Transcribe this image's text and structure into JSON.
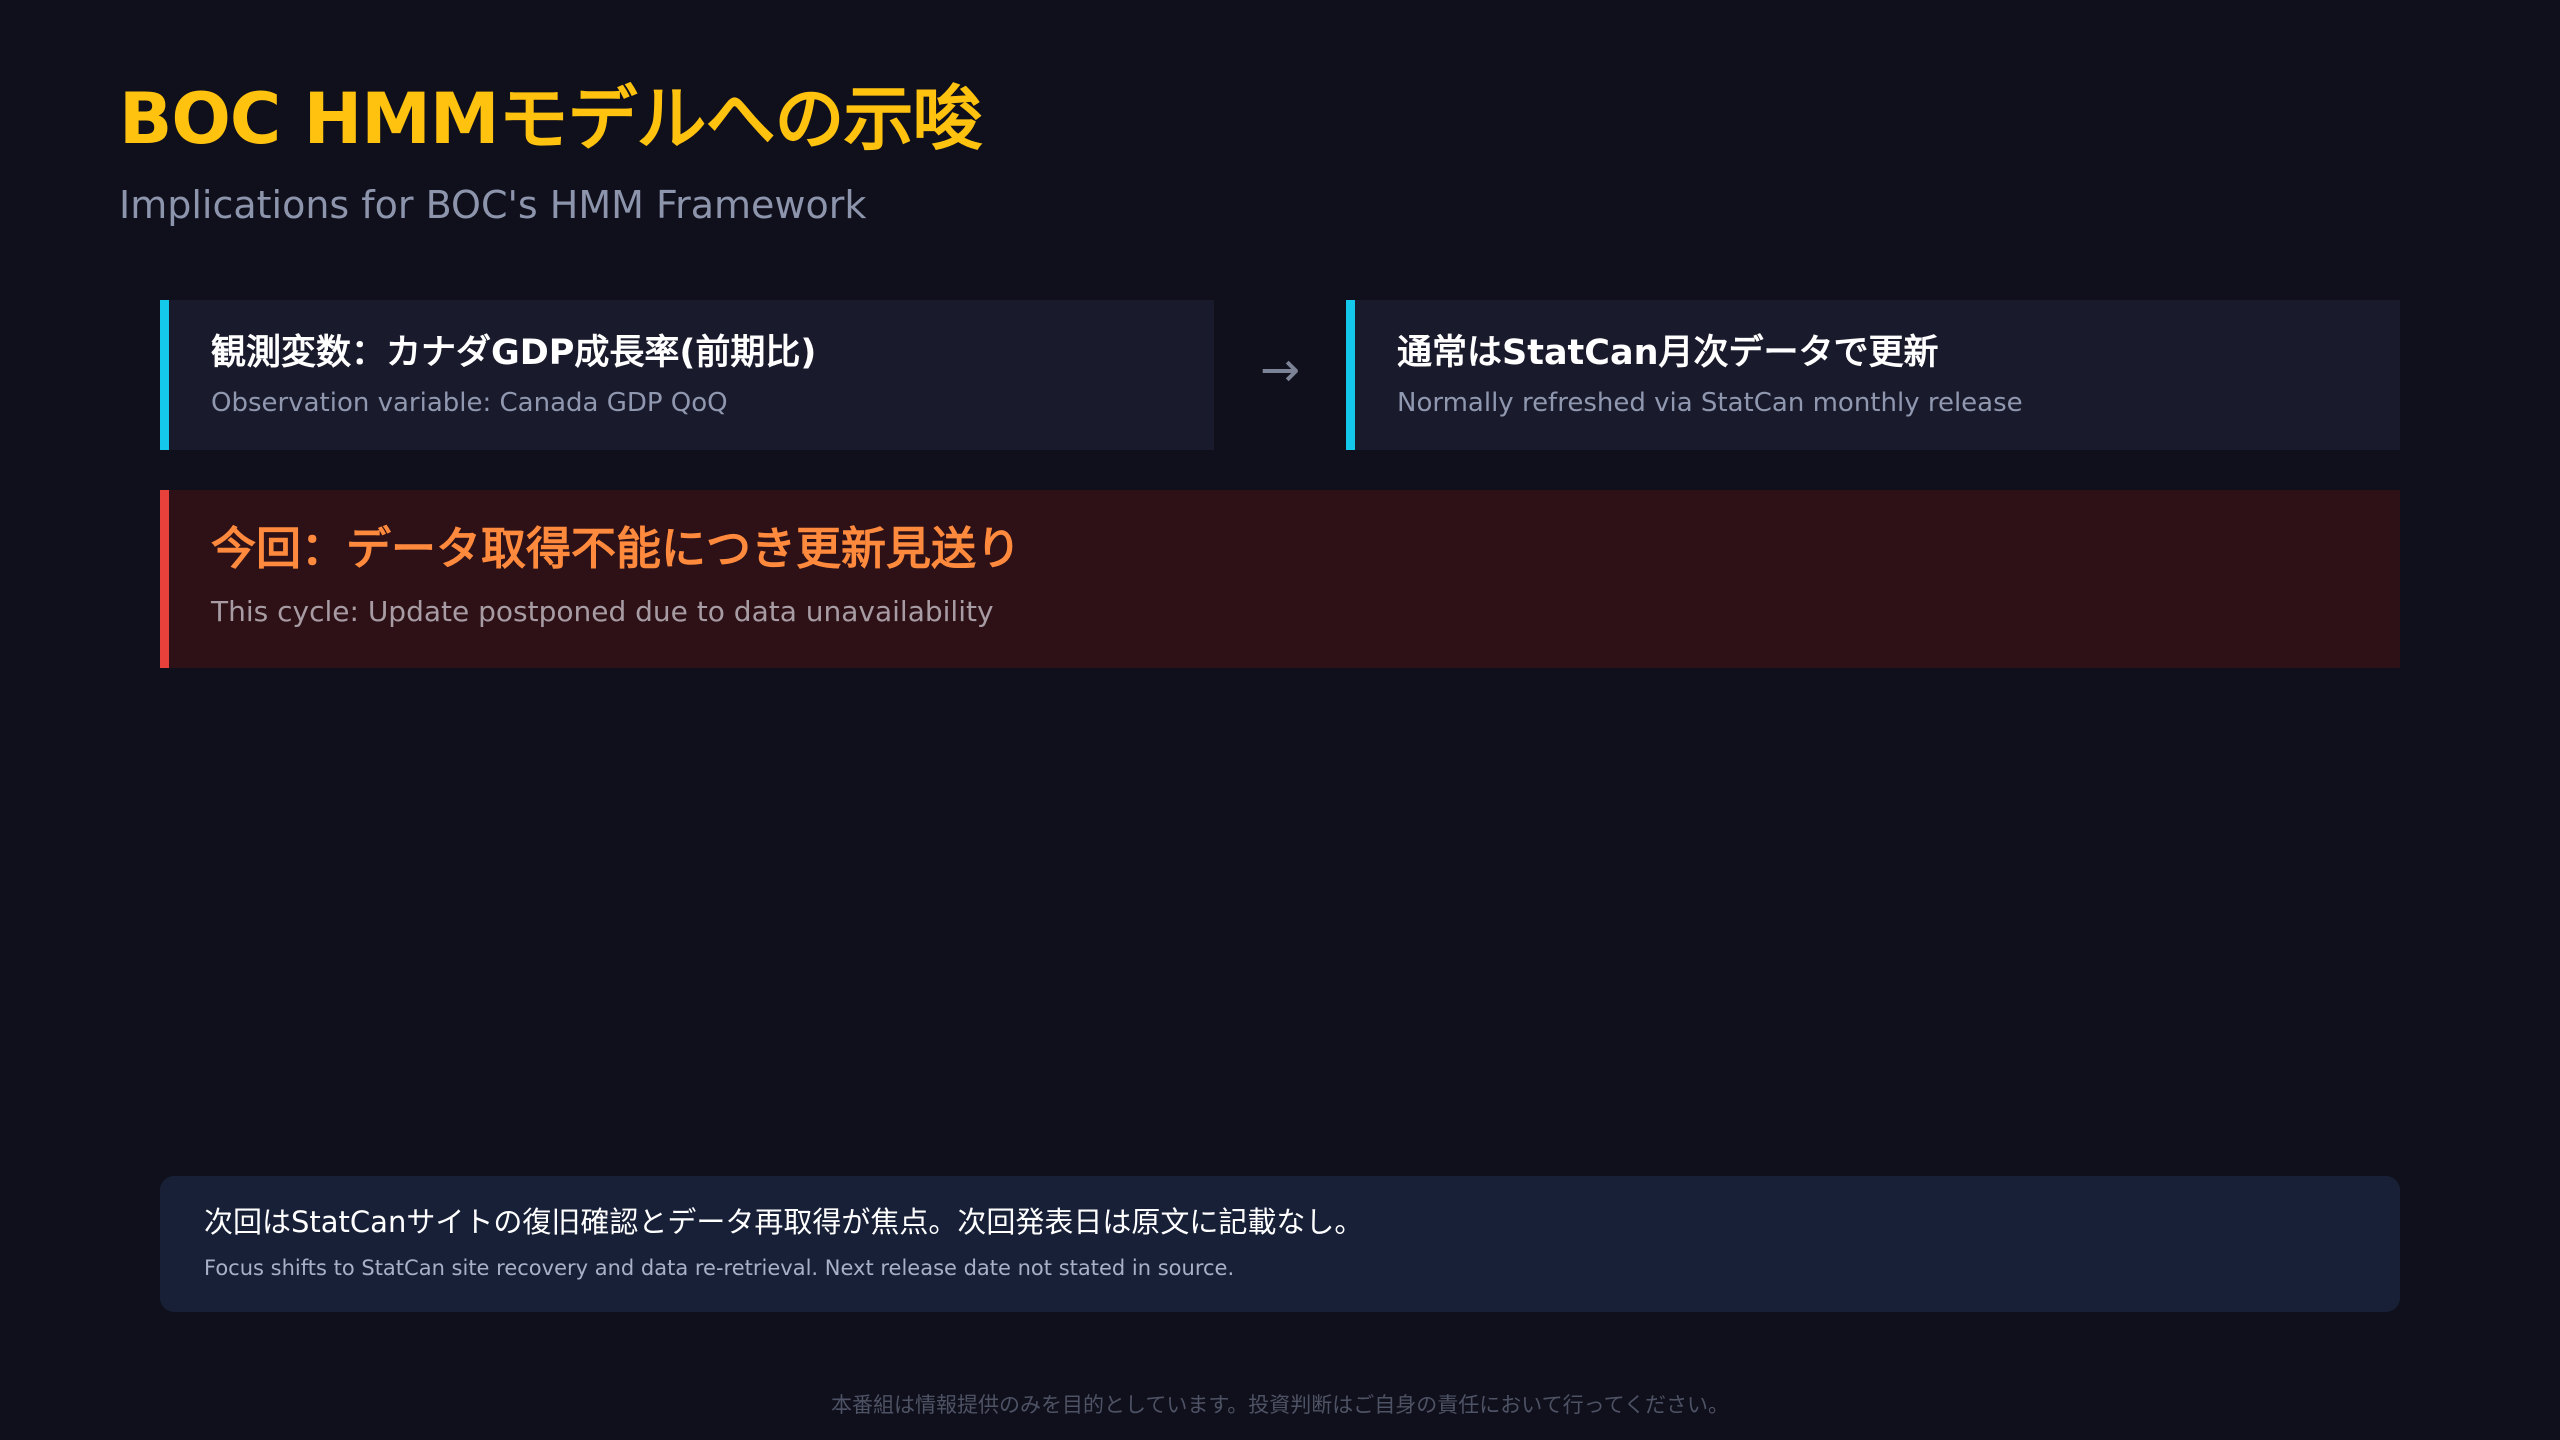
{
  "header": {
    "title": "BOC HMMモデルへの示唆",
    "subtitle": "Implications for BOC's HMM Framework"
  },
  "observation_card": {
    "heading": "観測変数：カナダGDP成長率(前期比)",
    "subheading": "Observation variable: Canada GDP QoQ"
  },
  "flow_arrow": {
    "glyph": "→",
    "icon": "right-arrow-icon"
  },
  "refresh_card": {
    "heading": "通常はStatCan月次データで更新",
    "subheading": "Normally refreshed via StatCan monthly release"
  },
  "alert_card": {
    "heading": "今回：データ取得不能につき更新見送り",
    "subheading": "This cycle: Update postponed due to data unavailability"
  },
  "next_note": {
    "heading": "次回はStatCanサイトの復旧確認とデータ再取得が焦点。次回発表日は原文に記載なし。",
    "subheading": "Focus shifts to StatCan site recovery and data re-retrieval. Next release date not stated in source."
  },
  "footer": {
    "disclaimer": "本番組は情報提供のみを目的としています。投資判断はご自身の責任において行ってください。"
  },
  "colors": {
    "background": "#10101c",
    "title": "#ffc20e",
    "info_accent": "#14c8ec",
    "alert_accent": "#e8403a",
    "alert_text": "#ff8a3d",
    "note_background": "#182038"
  }
}
